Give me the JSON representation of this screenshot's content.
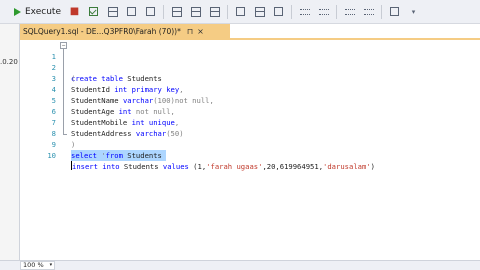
{
  "toolbar": {
    "execute_label": "Execute"
  },
  "left_panel": {
    "fragment": ".0.20"
  },
  "tab": {
    "title": "SQLQuery1.sql - DE...Q3PFR0\\Farah (70))*",
    "pin": "⊓",
    "close": "×"
  },
  "editor": {
    "lines": [
      {
        "n": "1",
        "collapse": "−"
      },
      {
        "n": "2"
      },
      {
        "n": "3"
      },
      {
        "n": "4"
      },
      {
        "n": "5"
      },
      {
        "n": "6"
      },
      {
        "n": "7"
      },
      {
        "n": "8"
      },
      {
        "n": "9"
      },
      {
        "n": "10"
      }
    ],
    "l1_a": "create table",
    "l1_b": " Students",
    "l2": "(",
    "l3_a": "StudentId ",
    "l3_b": "int primary key",
    "l3_c": ",",
    "l4_a": "StudentName ",
    "l4_b": "varchar",
    "l4_c": "(100)",
    "l4_d": "not null",
    "l4_e": ",",
    "l5_a": "StudentAge ",
    "l5_b": "int",
    "l5_c": " not null",
    "l5_d": ",",
    "l6_a": "StudentMobile ",
    "l6_b": "int unique",
    "l6_c": ",",
    "l7_a": "StudentAddress ",
    "l7_b": "varchar",
    "l7_c": "(50)",
    "l8": ")",
    "l9_a": "select",
    "l9_b": " '",
    "l9_c": "from",
    "l9_d": " Students",
    "l10_a": "insert into",
    "l10_b": " Students ",
    "l10_c": "values",
    "l10_d": " (1,",
    "l10_e": "'farah ugaas'",
    "l10_f": ",20,619964951,",
    "l10_g": "'darusalam'",
    "l10_h": ")"
  },
  "status": {
    "zoom": "100 %",
    "zoom_dropdown": "▾"
  }
}
